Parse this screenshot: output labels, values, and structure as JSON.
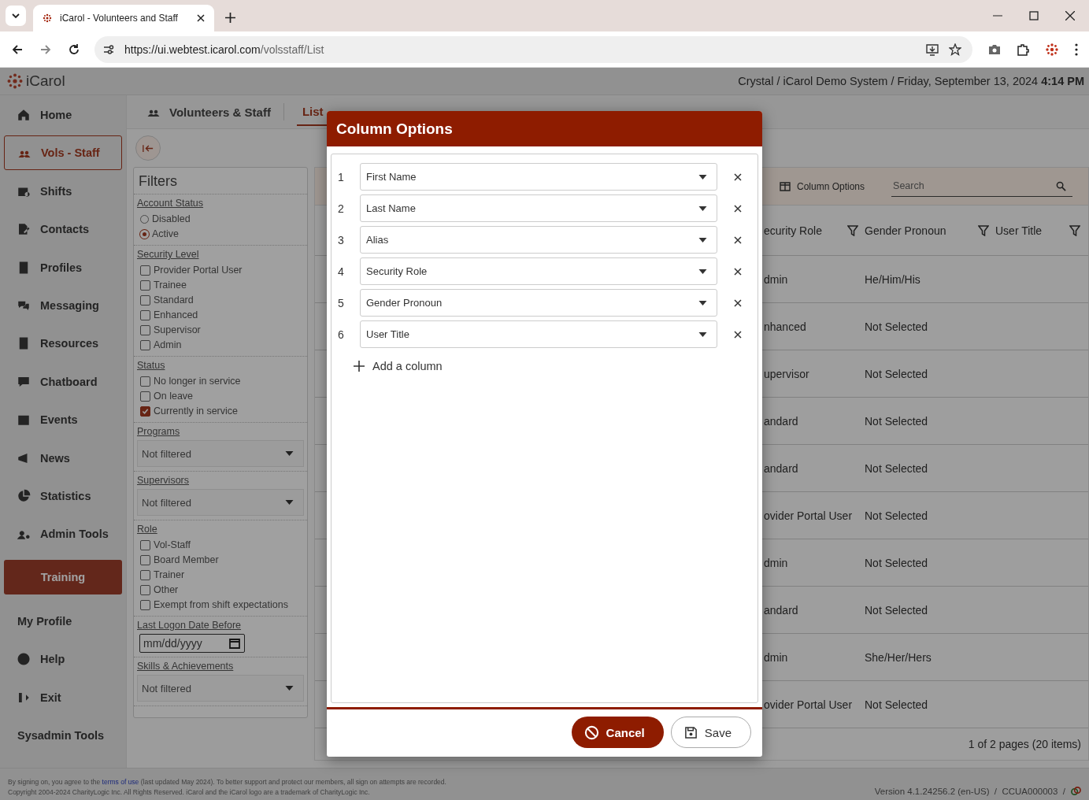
{
  "browser": {
    "tab_title": "iCarol - Volunteers and Staff",
    "url_host": "https://ui.webtest.icarol.com",
    "url_path": "/volsstaff/List"
  },
  "header": {
    "logo": "iCarol",
    "context": "Crystal / iCarol Demo System / Friday, September 13, 2024",
    "time": "4:14 PM"
  },
  "sidebar": {
    "items": [
      {
        "label": "Home",
        "kind": "icon-link",
        "selected": false
      },
      {
        "label": "Vols - Staff",
        "kind": "icon-link",
        "selected": true
      },
      {
        "label": "Shifts",
        "kind": "icon-link",
        "selected": false
      },
      {
        "label": "Contacts",
        "kind": "icon-link",
        "selected": false
      },
      {
        "label": "Profiles",
        "kind": "icon-link",
        "selected": false
      },
      {
        "label": "Messaging",
        "kind": "icon-link",
        "selected": false
      },
      {
        "label": "Resources",
        "kind": "icon-link",
        "selected": false
      },
      {
        "label": "Chatboard",
        "kind": "icon-link",
        "selected": false
      },
      {
        "label": "Events",
        "kind": "icon-link",
        "selected": false
      },
      {
        "label": "News",
        "kind": "icon-link",
        "selected": false
      },
      {
        "label": "Statistics",
        "kind": "icon-link",
        "selected": false
      },
      {
        "label": "Admin Tools",
        "kind": "icon-link",
        "selected": false
      },
      {
        "label": "Training",
        "kind": "button",
        "selected": false
      },
      {
        "label": "My Profile",
        "kind": "text-link",
        "selected": false
      },
      {
        "label": "Help",
        "kind": "icon-link",
        "selected": false
      },
      {
        "label": "Exit",
        "kind": "icon-link",
        "selected": false
      },
      {
        "label": "Sysadmin Tools",
        "kind": "text-link",
        "selected": false
      }
    ]
  },
  "page_tabs": {
    "title": "Volunteers & Staff",
    "tabs": [
      {
        "label": "List",
        "selected": true
      }
    ]
  },
  "filters": {
    "title": "Filters",
    "sections": [
      {
        "kind": "radio",
        "label": "Account Status",
        "options": [
          {
            "label": "Disabled",
            "selected": false
          },
          {
            "label": "Active",
            "selected": true
          }
        ]
      },
      {
        "kind": "checkbox",
        "label": "Security Level",
        "options": [
          {
            "label": "Provider Portal User",
            "checked": false
          },
          {
            "label": "Trainee",
            "checked": false
          },
          {
            "label": "Standard",
            "checked": false
          },
          {
            "label": "Enhanced",
            "checked": false
          },
          {
            "label": "Supervisor",
            "checked": false
          },
          {
            "label": "Admin",
            "checked": false
          }
        ]
      },
      {
        "kind": "checkbox",
        "label": "Status",
        "options": [
          {
            "label": "No longer in service",
            "checked": false
          },
          {
            "label": "On leave",
            "checked": false
          },
          {
            "label": "Currently in service",
            "checked": true
          }
        ]
      },
      {
        "kind": "select",
        "label": "Programs",
        "value": "Not filtered"
      },
      {
        "kind": "select",
        "label": "Supervisors",
        "value": "Not filtered"
      },
      {
        "kind": "checkbox",
        "label": "Role",
        "options": [
          {
            "label": "Vol-Staff",
            "checked": false
          },
          {
            "label": "Board Member",
            "checked": false
          },
          {
            "label": "Trainer",
            "checked": false
          },
          {
            "label": "Other",
            "checked": false
          },
          {
            "label": "Exempt from shift expectations",
            "checked": false
          }
        ]
      },
      {
        "kind": "date",
        "label": "Last Logon Date Before",
        "placeholder": "mm/dd/yyyy"
      },
      {
        "kind": "select",
        "label": "Skills & Achievements",
        "value": "Not filtered"
      }
    ]
  },
  "toolbar": {
    "column_options": "Column Options",
    "search_placeholder": "Search"
  },
  "table": {
    "columns": [
      "ecurity Role",
      "Gender Pronoun",
      "User Title"
    ],
    "rows": [
      {
        "security_role": "dmin",
        "gender_pronoun": "He/Him/His"
      },
      {
        "security_role": "nhanced",
        "gender_pronoun": "Not Selected"
      },
      {
        "security_role": "upervisor",
        "gender_pronoun": "Not Selected"
      },
      {
        "security_role": "andard",
        "gender_pronoun": "Not Selected"
      },
      {
        "security_role": "andard",
        "gender_pronoun": "Not Selected"
      },
      {
        "security_role": "ovider Portal User",
        "gender_pronoun": "Not Selected"
      },
      {
        "security_role": "dmin",
        "gender_pronoun": "Not Selected"
      },
      {
        "security_role": "andard",
        "gender_pronoun": "Not Selected"
      },
      {
        "security_role": "dmin",
        "gender_pronoun": "She/Her/Hers"
      },
      {
        "security_role": "ovider Portal User",
        "gender_pronoun": "Not Selected"
      }
    ]
  },
  "pagination": "1 of 2 pages (20 items)",
  "modal": {
    "title": "Column Options",
    "columns": [
      {
        "number": "1",
        "value": "First Name"
      },
      {
        "number": "2",
        "value": "Last Name"
      },
      {
        "number": "3",
        "value": "Alias"
      },
      {
        "number": "4",
        "value": "Security Role"
      },
      {
        "number": "5",
        "value": "Gender Pronoun"
      },
      {
        "number": "6",
        "value": "User Title"
      }
    ],
    "add_label": "Add a column",
    "buttons": [
      {
        "label": "Cancel",
        "kind": "primary"
      },
      {
        "label": "Save",
        "kind": "secondary"
      }
    ]
  },
  "footer": {
    "notice_before": "By signing on, you agree to the",
    "notice_link": "terms of use",
    "notice_after": "(last updated May 2024). To better support and protect our members, all sign on attempts are recorded.",
    "copyright": "Copyright 2004-2024 CharityLogic Inc. All Rights Reserved. iCarol and the iCarol logo are a trademark of CharityLogic Inc.",
    "version": "Version 4.1.24256.2 (en-US)  /  CCUA000003  /"
  }
}
